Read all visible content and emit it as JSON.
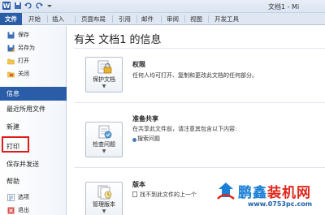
{
  "window": {
    "title": "文档1 - Mi",
    "quick_access_icons": [
      "word-icon",
      "save-icon",
      "undo-icon",
      "redo-icon",
      "customize-icon"
    ]
  },
  "ribbon": {
    "tabs": [
      "文件",
      "开始",
      "插入",
      "页面布局",
      "引用",
      "邮件",
      "审阅",
      "视图",
      "开发工具"
    ],
    "file_tab_color": "#2a5da8"
  },
  "sidebar": {
    "small_items": [
      {
        "label": "保存",
        "icon": "save-icon"
      },
      {
        "label": "另存为",
        "icon": "save-as-icon"
      },
      {
        "label": "打开",
        "icon": "open-folder-icon"
      },
      {
        "label": "关闭",
        "icon": "close-doc-icon"
      }
    ],
    "big_items": [
      "信息",
      "最近所用文件",
      "新建",
      "打印",
      "保存并发送",
      "帮助"
    ],
    "active_item": "信息",
    "bottom_items": [
      {
        "label": "选项",
        "icon": "options-icon"
      },
      {
        "label": "退出",
        "icon": "exit-icon"
      }
    ],
    "highlight_color": "#e01b1b"
  },
  "main": {
    "title": "有关 文档1 的信息",
    "sections": [
      {
        "button_label": "保护文档",
        "button_icon": "lock-icon",
        "title": "权限",
        "description": "任何人均可打开、复制和更改此文档的任何部分。"
      },
      {
        "button_label": "检查问题",
        "button_icon": "check-doc-icon",
        "title": "准备共享",
        "description": "在共享此文件前，请注意其包含以下内容:",
        "bullets": [
          "搜索问题"
        ]
      },
      {
        "button_label": "管理版本",
        "button_icon": "versions-icon",
        "title": "版本",
        "description": "找不到此文件的上一个"
      }
    ]
  },
  "watermark": {
    "name_part1": "鹏鑫",
    "name_part2": "装机网",
    "url": "www.0753pc.com",
    "color1": "#1a7fd6",
    "color2": "#e0261b"
  }
}
